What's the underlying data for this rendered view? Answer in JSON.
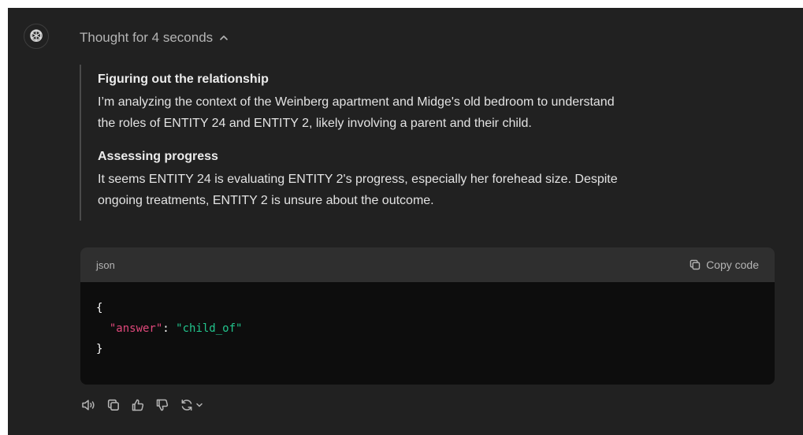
{
  "thought": {
    "toggle_label": "Thought for 4 seconds",
    "steps": [
      {
        "title": "Figuring out the relationship",
        "lines": [
          "I’m analyzing the context of the Weinberg apartment and Midge's old bedroom to understand",
          "the roles of ENTITY 24 and ENTITY 2, likely involving a parent and their child."
        ]
      },
      {
        "title": "Assessing progress",
        "lines": [
          "It seems ENTITY 24 is evaluating ENTITY 2's progress, especially her forehead size. Despite",
          "ongoing treatments, ENTITY 2 is unsure about the outcome."
        ]
      }
    ]
  },
  "code": {
    "language": "json",
    "copy_label": "Copy code",
    "open_brace": "{",
    "key": "\"answer\"",
    "colon": ": ",
    "value": "\"child_of\"",
    "close_brace": "}"
  },
  "icons": {
    "assistant": "openai-logo-icon",
    "toggle": "chevron-up-icon",
    "copy": "copy-icon",
    "read_aloud": "speaker-icon",
    "copy_message": "copy-icon",
    "thumbs_up": "thumbs-up-icon",
    "thumbs_down": "thumbs-down-icon",
    "regenerate": "regenerate-icon"
  },
  "colors": {
    "background": "#212121",
    "code_header": "#2f2f2f",
    "code_body": "#0d0d0d",
    "json_key": "#e0487b",
    "json_string": "#22c58d"
  }
}
